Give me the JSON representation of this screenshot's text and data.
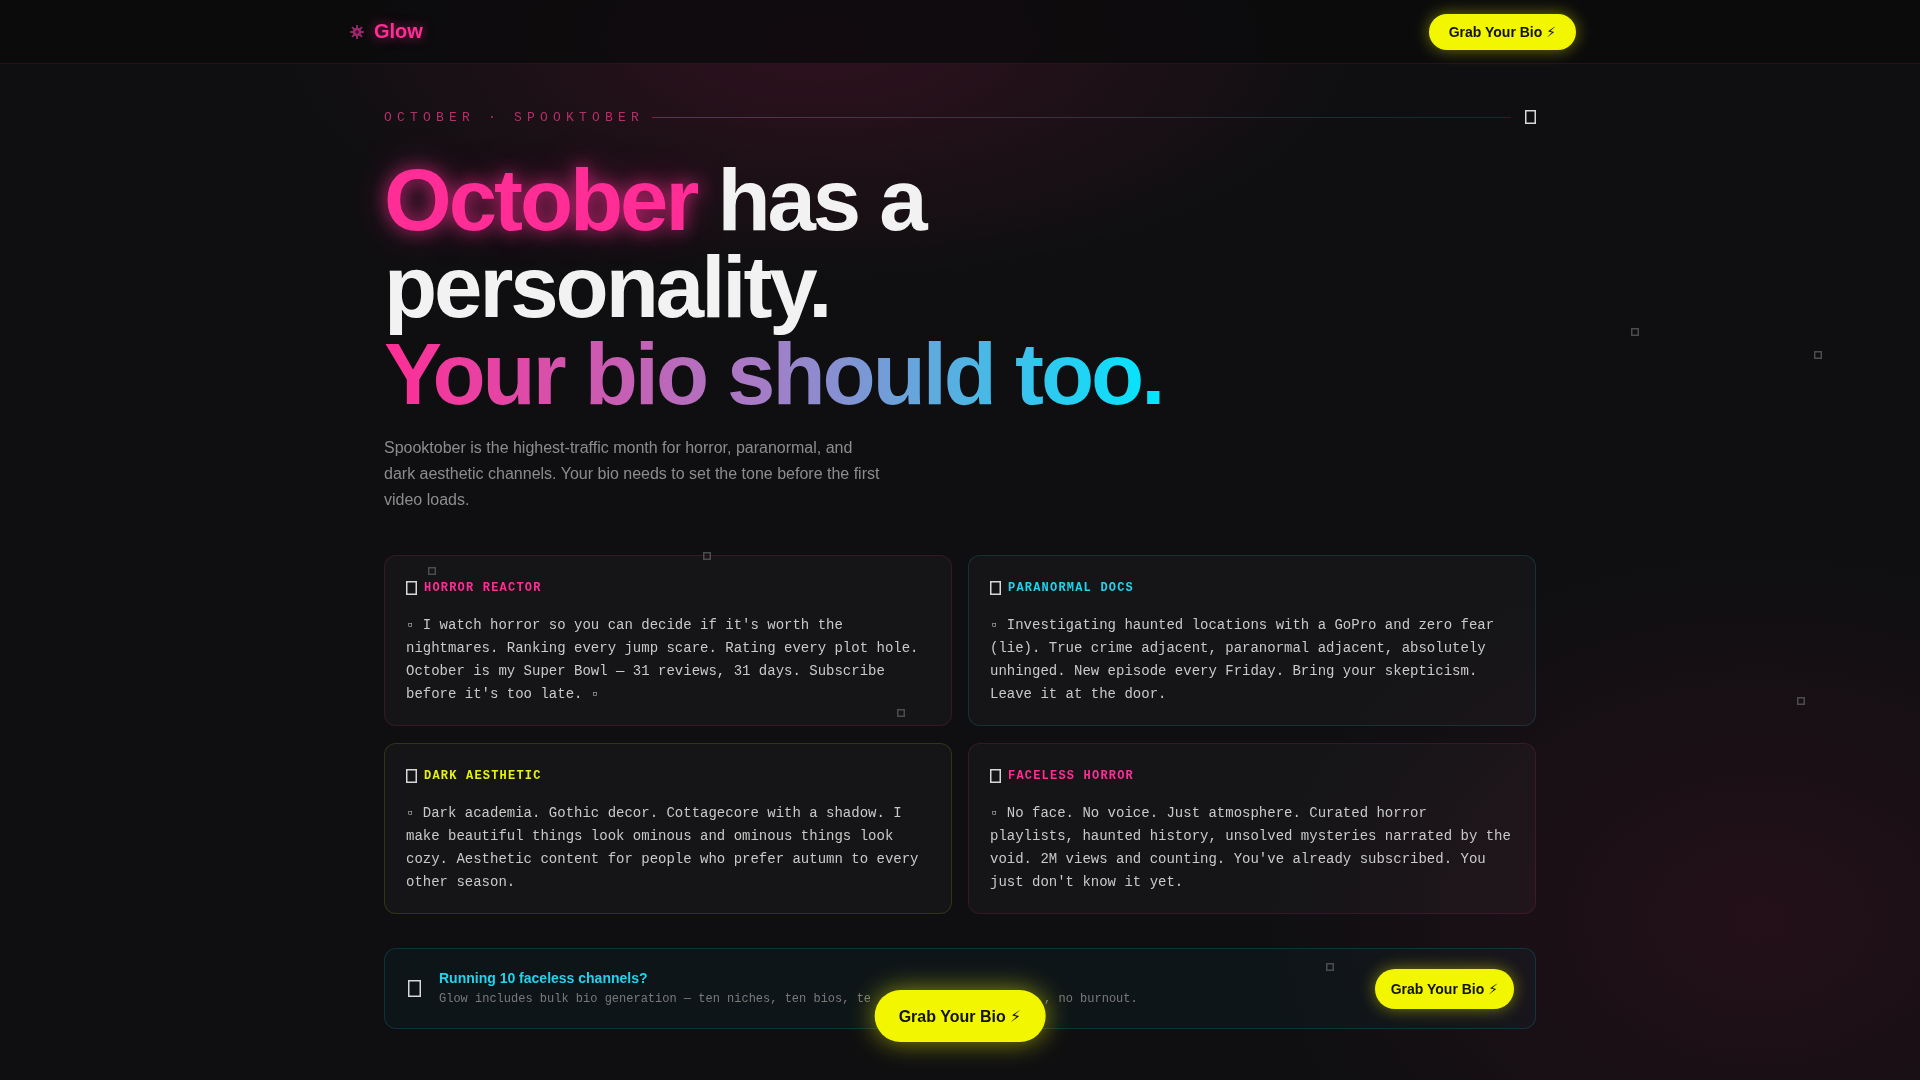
{
  "nav": {
    "brand": "Glow",
    "cta": "Grab Your Bio ⚡"
  },
  "eyebrow": "OCTOBER · SPOOKTOBER",
  "headline": [
    {
      "text": "October",
      "kind": "glow"
    },
    {
      "text": "has a personality.",
      "kind": "plain"
    },
    {
      "text": "Your bio should too.",
      "kind": "gradient"
    }
  ],
  "intro": "Spooktober is the highest-traffic month for horror, paranormal, and dark aesthetic channels. Your bio needs to set the tone before the first video loads.",
  "cards": [
    {
      "title": "HORROR REACTOR",
      "color": "#ff2d95",
      "bio": "▫ I watch horror so you can decide if it's worth the nightmares. Ranking every jump scare. Rating every plot hole. October is my Super Bowl — 31 reviews, 31 days. Subscribe before it's too late. ▫"
    },
    {
      "title": "PARANORMAL DOCS",
      "color": "#22d3ee",
      "bio": "▫ Investigating haunted locations with a GoPro and zero fear (lie). True crime adjacent, paranormal adjacent, absolutely unhinged. New episode every Friday. Bring your skepticism. Leave it at the door."
    },
    {
      "title": "DARK AESTHETIC",
      "color": "#e6f20f",
      "bio": "▫ Dark academia. Gothic decor. Cottagecore with a shadow. I make beautiful things look ominous and ominous things look cozy. Aesthetic content for people who prefer autumn to every other season."
    },
    {
      "title": "FACELESS HORROR",
      "color": "#ff2d95",
      "bio": "▫ No face. No voice. Just atmosphere. Curated horror playlists, haunted history, unsolved mysteries narrated by the void. 2M views and counting. You've already subscribed. You just don't know it yet."
    }
  ],
  "banner": {
    "title": "Running 10 faceless channels?",
    "subtitle_parts": [
      "Glow includes bulk bio generation — ten niches, ten bios, te",
      ", no burnout."
    ],
    "cta": "Grab Your Bio ⚡"
  },
  "floating_cta": "Grab Your Bio ⚡"
}
